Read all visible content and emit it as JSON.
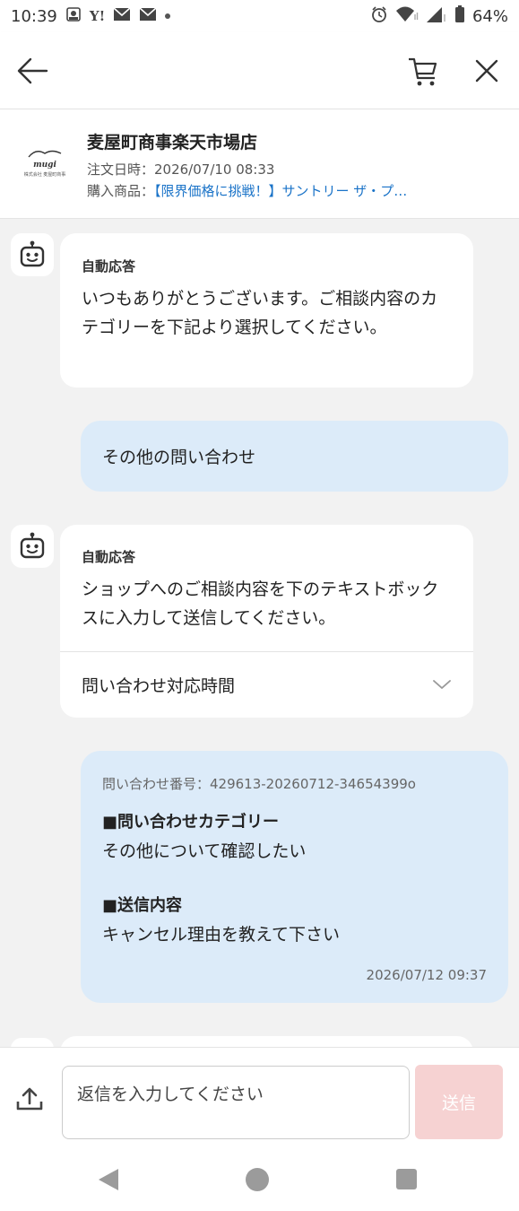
{
  "status_bar": {
    "time": "10:39",
    "battery": "64%",
    "icons": [
      "notification-icon",
      "yahoo-icon",
      "mail-icon",
      "mail-icon",
      "dot-icon",
      "alarm-icon",
      "wifi-icon",
      "signal-icon",
      "battery-icon"
    ]
  },
  "header": {
    "icons": [
      "back-arrow-icon",
      "cart-icon",
      "close-icon"
    ]
  },
  "shop": {
    "name": "麦屋町商事楽天市場店",
    "order_date": "注文日時：2026/07/10 08:33",
    "item_label": "購入商品：",
    "item_link": "【限界価格に挑戦！】サントリー ザ・プ…",
    "logo_text": "mugi",
    "logo_subtext": "株式会社 麦屋町商事"
  },
  "chat": {
    "message1": {
      "label": "自動応答",
      "text": "いつもありがとうございます。ご相談内容のカテゴリーを下記より選択してください。"
    },
    "user1": {
      "text": "その他の問い合わせ"
    },
    "message2": {
      "label": "自動応答",
      "text": "ショップへのご相談内容を下のテキストボックスに入力して送信してください。",
      "hours_label": "問い合わせ対応時間"
    },
    "user2": {
      "inquiry_no": "問い合わせ番号：429613-20260712-34654399o",
      "category_title": "■問い合わせカテゴリー",
      "category_value": "その他について確認したい",
      "content_title": "■送信内容",
      "content_value": "キャンセル理由を教えて下さい",
      "timestamp": "2026/07/12 09:37"
    }
  },
  "input": {
    "placeholder": "返信を入力してください",
    "send_label": "送信"
  },
  "colors": {
    "link": "#1a73c8",
    "user_bubble": "#dcebf9",
    "send_disabled": "#f6d2d2"
  }
}
